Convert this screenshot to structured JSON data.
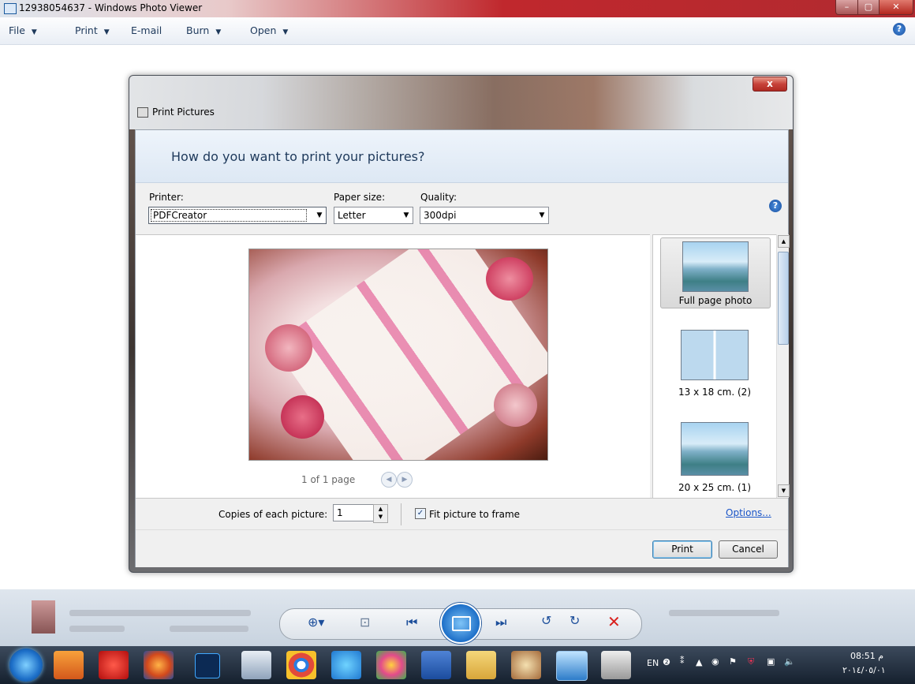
{
  "window": {
    "title": "12938054637 - Windows Photo Viewer",
    "controls": [
      "–",
      "▢",
      "✕"
    ]
  },
  "menubar": {
    "items": [
      {
        "label": "File",
        "arrow": "▼"
      },
      {
        "label": "Print",
        "arrow": "▼"
      },
      {
        "label": "E-mail"
      },
      {
        "label": "Burn",
        "arrow": "▼"
      },
      {
        "label": "Open",
        "arrow": "▼"
      }
    ],
    "help": "?"
  },
  "dialog": {
    "title": "Print Pictures",
    "close": "x",
    "question": "How do you want to print your pictures?",
    "printer": {
      "label": "Printer:",
      "value": "PDFCreator"
    },
    "paper_size": {
      "label": "Paper size:",
      "value": "Letter"
    },
    "quality": {
      "label": "Quality:",
      "value": "300dpi"
    },
    "help": "?",
    "pager": "1 of 1 page",
    "layouts": [
      {
        "label": "Full page photo",
        "selected": true
      },
      {
        "label": "13 x 18 cm. (2)"
      },
      {
        "label": "20 x 25 cm. (1)"
      }
    ],
    "copies_label": "Copies of each picture:",
    "copies_value": "1",
    "fit_label": "Fit picture to frame",
    "fit_checked": true,
    "options_link": "Options...",
    "print_button": "Print",
    "cancel_button": "Cancel"
  },
  "taskbar": {
    "lang": "EN",
    "time": "08:51 م",
    "date": "٢٠١٤/٠٥/٠١"
  },
  "colors": {
    "accent": "#1e395b",
    "link": "#1a55c8",
    "titlebar_red": "#c0282d",
    "delete": "#d9201c"
  }
}
